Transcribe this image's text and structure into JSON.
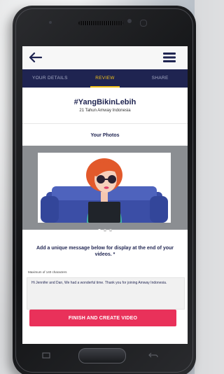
{
  "header": {
    "back_icon": "arrow-left-icon",
    "menu_icon": "hamburger-menu-icon"
  },
  "tabs": [
    {
      "label": "YOUR DETAILS",
      "active": false
    },
    {
      "label": "REVIEW",
      "active": true
    },
    {
      "label": "SHARE",
      "active": false
    }
  ],
  "campaign": {
    "hashtag": "#YangBikinLebih",
    "subtitle": "21 Tahun Amway Indonesia"
  },
  "photos": {
    "title": "Your Photos",
    "carousel_pages": 3,
    "current_page": 1
  },
  "message": {
    "instruction": "Add a unique message below for display at the end of your videos. *",
    "max_chars_label": "Maximum of 140 characters",
    "value": "Hi Jennifer and Dan, We had a wonderful time. Thank you for joining Amway Indonesia."
  },
  "actions": {
    "finish_label": "FINISH AND CREATE VIDEO"
  },
  "colors": {
    "nav_bg": "#1f2451",
    "active_tab": "#f3c21b",
    "primary_button": "#e9315a"
  }
}
